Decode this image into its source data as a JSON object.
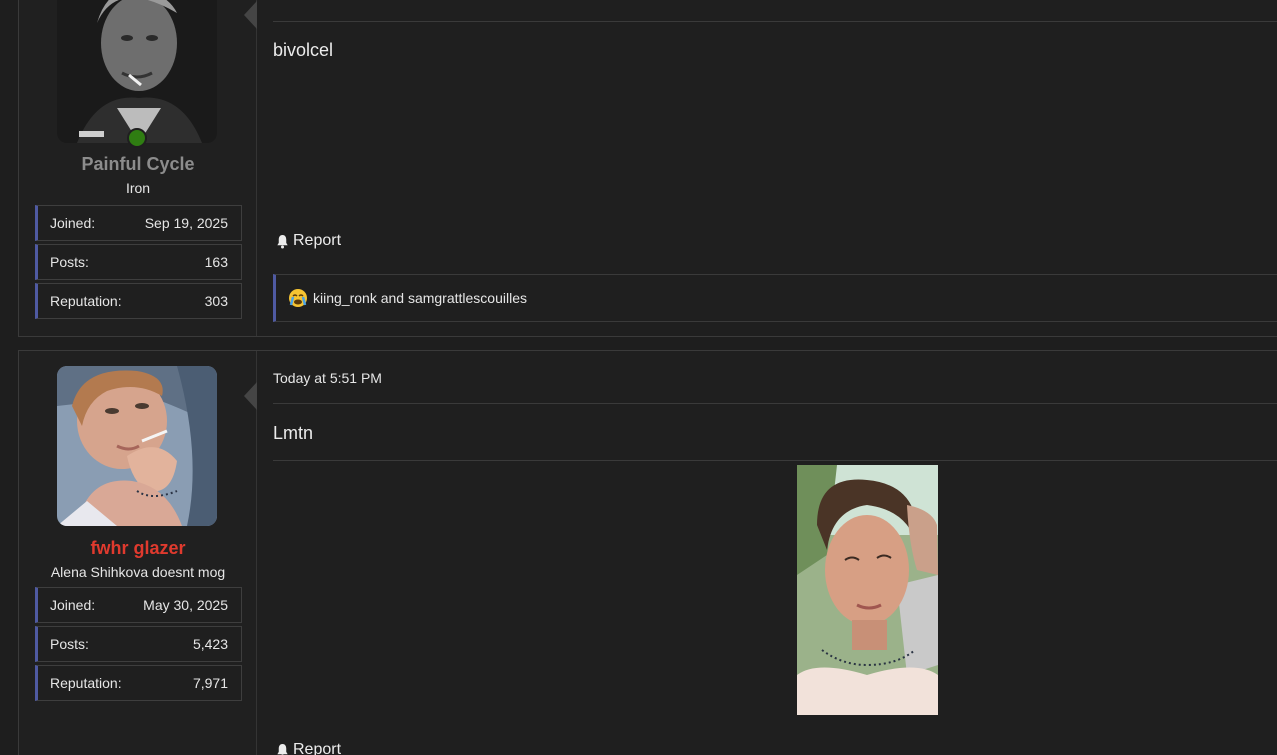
{
  "posts": [
    {
      "user": {
        "name": "Painful Cycle",
        "title": "Iron",
        "online": true,
        "avatar_icon": "avatar-photo-man-smoking",
        "stats": [
          {
            "label": "Joined:",
            "value": "Sep 19, 2025"
          },
          {
            "label": "Posts:",
            "value": "163"
          },
          {
            "label": "Reputation:",
            "value": "303"
          }
        ]
      },
      "message": "bivolcel",
      "report_label": "Report",
      "reactions": {
        "icon": "crying-face-emoji",
        "text": "kiing_ronk and samgrattlescouilles"
      }
    },
    {
      "user": {
        "name": "fwhr glazer",
        "title": "Alena Shihkova doesnt mog",
        "avatar_icon": "avatar-photo-woman-smoking",
        "stats": [
          {
            "label": "Joined:",
            "value": "May 30, 2025"
          },
          {
            "label": "Posts:",
            "value": "5,423"
          },
          {
            "label": "Reputation:",
            "value": "7,971"
          }
        ]
      },
      "date": "Today at 5:51 PM",
      "message": "Lmtn",
      "attachment_icon": "photo-woman-selfie",
      "report_label": "Report"
    }
  ],
  "colors": {
    "background": "#1e1e1e",
    "accent_border": "#4f5aa2",
    "username_staff": "#e03a2e",
    "username_default": "#8c8c8c",
    "online": "#2f7d12"
  }
}
